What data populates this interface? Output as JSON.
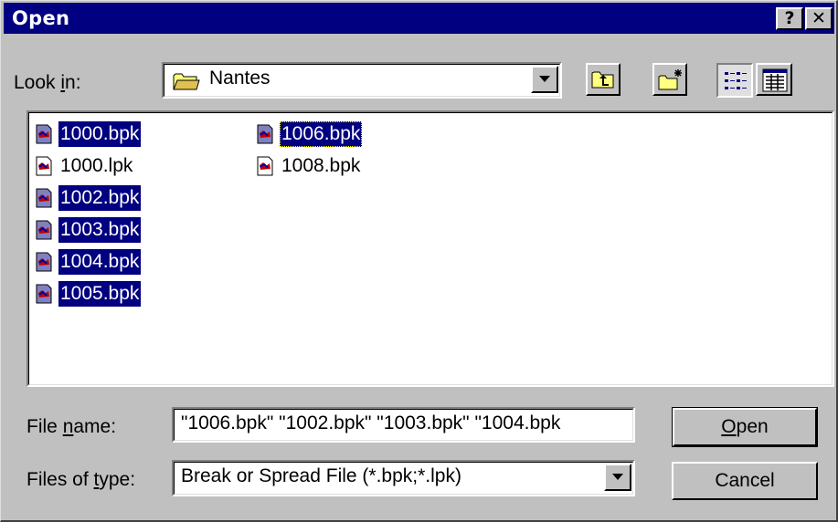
{
  "window": {
    "title": "Open",
    "help_label": "?",
    "close_label": "✕"
  },
  "look_in": {
    "label_pre": "Look ",
    "label_key": "i",
    "label_post": "n:",
    "folder": "Nantes"
  },
  "files": [
    {
      "name": "1000.bpk",
      "selected": true
    },
    {
      "name": "1000.lpk",
      "selected": false
    },
    {
      "name": "1002.bpk",
      "selected": true
    },
    {
      "name": "1003.bpk",
      "selected": true
    },
    {
      "name": "1004.bpk",
      "selected": true
    },
    {
      "name": "1005.bpk",
      "selected": true
    },
    {
      "name": "1006.bpk",
      "selected": true,
      "focused": true
    },
    {
      "name": "1008.bpk",
      "selected": false
    }
  ],
  "file_name": {
    "label_pre": "File ",
    "label_key": "n",
    "label_post": "ame:",
    "value": "\"1006.bpk\" \"1002.bpk\" \"1003.bpk\" \"1004.bpk"
  },
  "file_type": {
    "label_pre": "Files of ",
    "label_key": "t",
    "label_post": "ype:",
    "value": "Break or Spread File (*.bpk;*.lpk)"
  },
  "buttons": {
    "open_key": "O",
    "open_rest": "pen",
    "cancel": "Cancel"
  },
  "colors": {
    "title_bar": "#000080",
    "selection": "#000080",
    "face": "#c0c0c0"
  }
}
